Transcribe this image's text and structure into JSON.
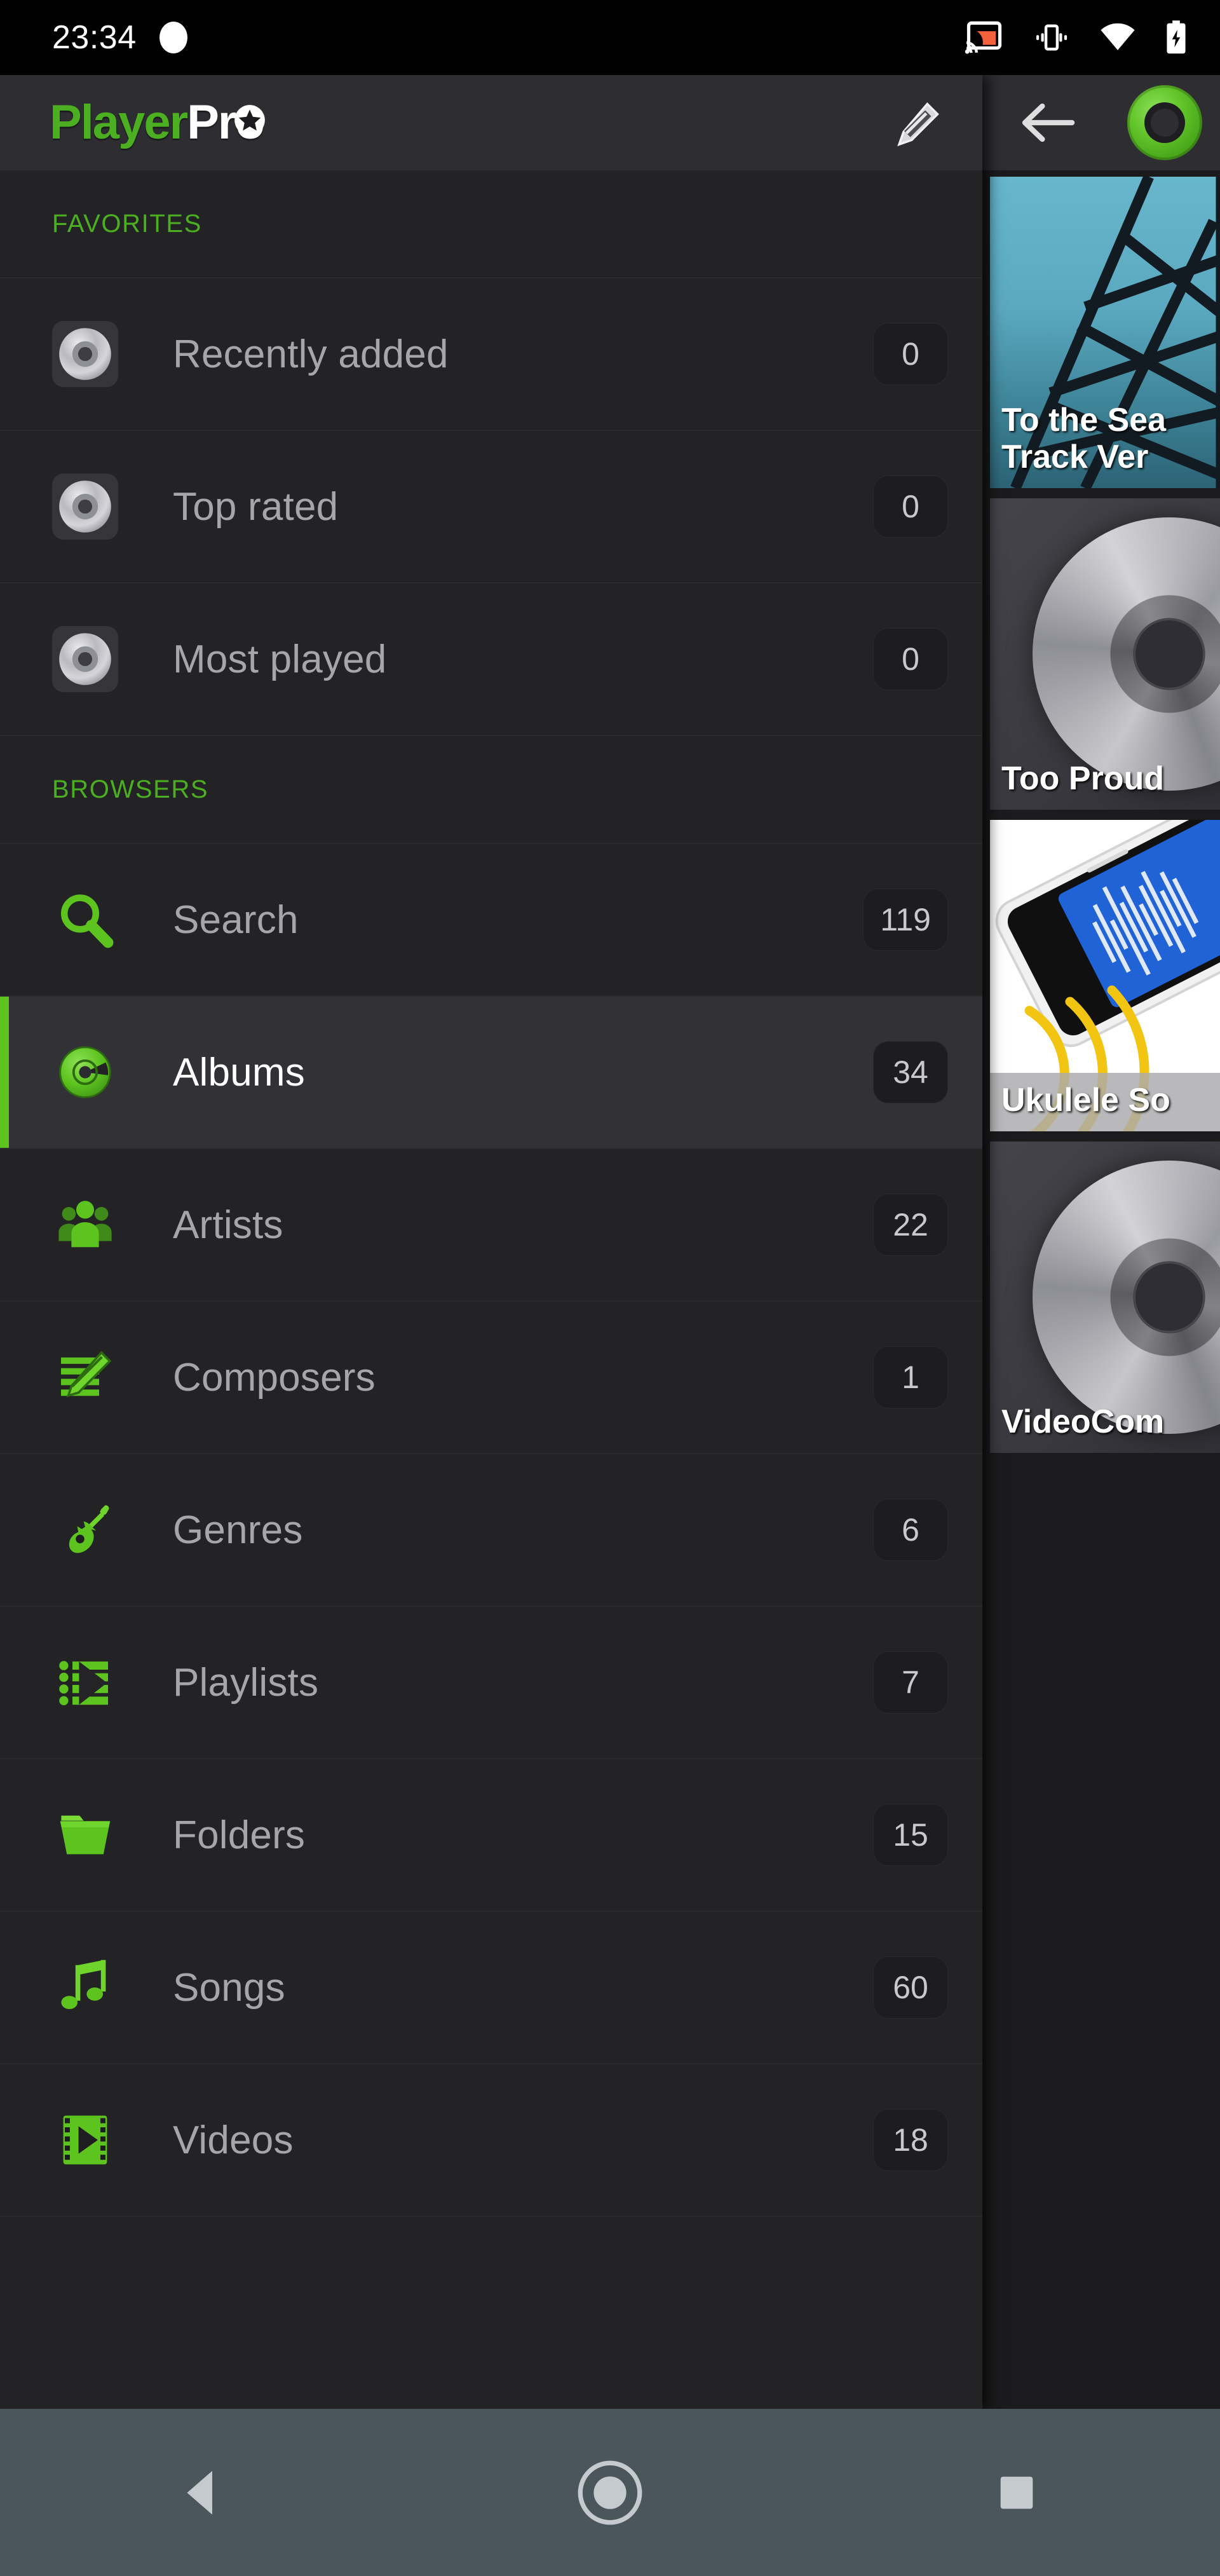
{
  "status_bar": {
    "clock": "23:34",
    "icons": [
      "camera-dot-icon",
      "cast-icon",
      "vibrate-icon",
      "wifi-icon",
      "battery-charging-icon"
    ],
    "cast_color": "#f4603c"
  },
  "drawer": {
    "logo": {
      "part1": "Player",
      "part2": "Pro",
      "part1_color": "#4caf21",
      "part2_color": "#ffffff"
    },
    "edit_button": "edit-pencil",
    "sections": [
      {
        "title": "FAVORITES",
        "items": [
          {
            "label": "Recently added",
            "count": "0",
            "icon": "cd-disc-icon"
          },
          {
            "label": "Top rated",
            "count": "0",
            "icon": "cd-disc-icon"
          },
          {
            "label": "Most played",
            "count": "0",
            "icon": "cd-disc-icon"
          }
        ]
      },
      {
        "title": "BROWSERS",
        "items": [
          {
            "label": "Search",
            "count": "119",
            "icon": "magnifier-icon",
            "selected": false
          },
          {
            "label": "Albums",
            "count": "34",
            "icon": "green-disc-icon",
            "selected": true
          },
          {
            "label": "Artists",
            "count": "22",
            "icon": "people-icon",
            "selected": false
          },
          {
            "label": "Composers",
            "count": "1",
            "icon": "note-pencil-icon",
            "selected": false
          },
          {
            "label": "Genres",
            "count": "6",
            "icon": "guitar-icon",
            "selected": false
          },
          {
            "label": "Playlists",
            "count": "7",
            "icon": "playlist-icon",
            "selected": false
          },
          {
            "label": "Folders",
            "count": "15",
            "icon": "folder-icon",
            "selected": false
          },
          {
            "label": "Songs",
            "count": "60",
            "icon": "music-note-icon",
            "selected": false
          },
          {
            "label": "Videos",
            "count": "18",
            "icon": "film-play-icon",
            "selected": false
          }
        ]
      }
    ],
    "accent_color": "#4caf21",
    "selected_indicator_color": "#5dc31f"
  },
  "content": {
    "back_button": "back-arrow",
    "header_icon": "green-disc-icon",
    "albums": [
      {
        "title": "To the Sea\nTrack Ver",
        "art": "sea-bridge"
      },
      {
        "title": "Too Proud",
        "art": "cd-placeholder"
      },
      {
        "title": "Ukulele So",
        "art": "ukulele-phone"
      },
      {
        "title": "VideoCom",
        "art": "cd-placeholder"
      }
    ]
  },
  "navbar": {
    "buttons": [
      {
        "label": "Back",
        "icon": "nav-back-triangle-icon"
      },
      {
        "label": "Home",
        "icon": "nav-home-circle-icon"
      },
      {
        "label": "Recents",
        "icon": "nav-recents-square-icon"
      }
    ],
    "background": "#4b555c"
  }
}
